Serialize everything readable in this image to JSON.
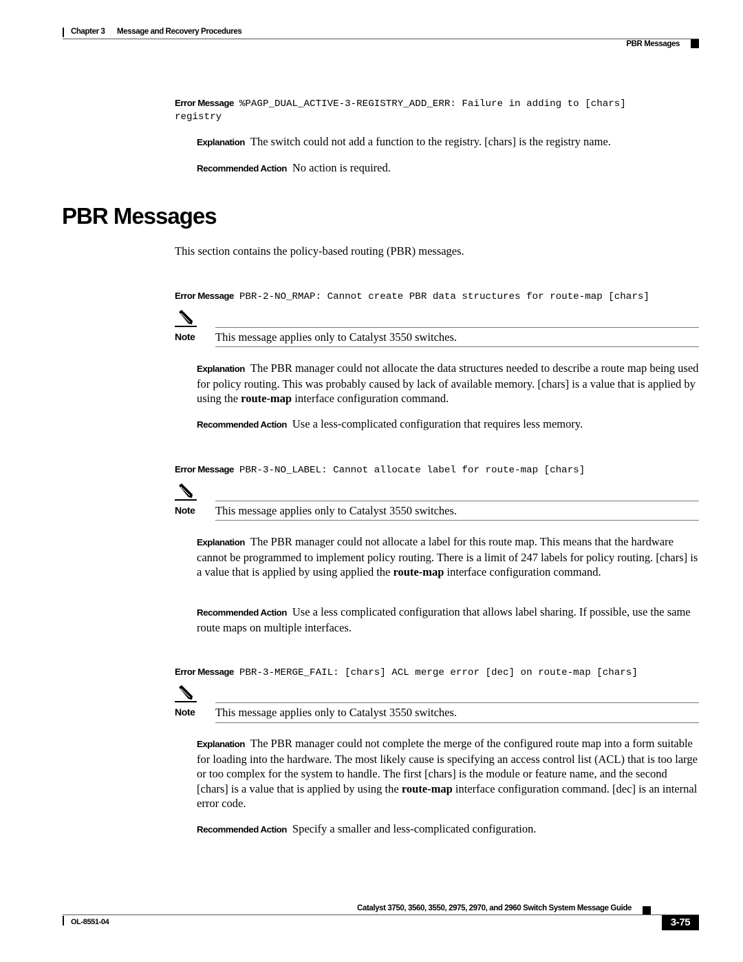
{
  "header": {
    "chapter": "Chapter 3",
    "chapter_title": "Message and Recovery Procedures",
    "section": "PBR Messages"
  },
  "entries_top": {
    "error_label": "Error Message",
    "error_code_line1": "%PAGP_DUAL_ACTIVE-3-REGISTRY_ADD_ERR: Failure in adding to [chars]",
    "error_code_line2": "registry",
    "explanation_label": "Explanation",
    "explanation": "The switch could not add a function to the registry. [chars] is the registry name.",
    "action_label": "Recommended Action",
    "action": "No action is required."
  },
  "section": {
    "title": "PBR Messages",
    "intro": "This section contains the policy-based routing (PBR) messages."
  },
  "messages": [
    {
      "error_label": "Error Message",
      "code": "PBR-2-NO_RMAP: Cannot create PBR data structures for route-map [chars]",
      "note_label": "Note",
      "note": "This message applies only to Catalyst 3550 switches.",
      "explanation_label": "Explanation",
      "explanation_pre": "The PBR manager could not allocate the data structures needed to describe a route map being used for policy routing. This was probably caused by lack of available memory. [chars] is a value that is applied by using the ",
      "explanation_kw": "route-map",
      "explanation_post": " interface configuration command.",
      "action_label": "Recommended Action",
      "action": "Use a less-complicated configuration that requires less memory."
    },
    {
      "error_label": "Error Message",
      "code": "PBR-3-NO_LABEL: Cannot allocate label for route-map [chars]",
      "note_label": "Note",
      "note": "This message applies only to Catalyst 3550 switches.",
      "explanation_label": "Explanation",
      "explanation_pre": "The PBR manager could not allocate a label for this route map. This means that the hardware cannot be programmed to implement policy routing. There is a limit of 247 labels for policy routing. [chars] is a value that is applied by using applied the ",
      "explanation_kw": "route-map",
      "explanation_post": " interface configuration command.",
      "action_label": "Recommended Action",
      "action": "Use a less complicated configuration that allows label sharing. If possible, use the same route maps on multiple interfaces."
    },
    {
      "error_label": "Error Message",
      "code": "PBR-3-MERGE_FAIL: [chars] ACL merge error [dec] on route-map [chars]",
      "note_label": "Note",
      "note": "This message applies only to Catalyst 3550 switches.",
      "explanation_label": "Explanation",
      "explanation_pre": "The PBR manager could not complete the merge of the configured route map into a form suitable for loading into the hardware. The most likely cause is specifying an access control list (ACL) that is too large or too complex for the system to handle. The first [chars] is the module or feature name, and the second [chars] is a value that is applied by using the ",
      "explanation_kw": "route-map",
      "explanation_post": " interface configuration command. [dec] is an internal error code.",
      "action_label": "Recommended Action",
      "action": "Specify a smaller and less-complicated configuration."
    }
  ],
  "footer": {
    "guide_title": "Catalyst 3750, 3560, 3550, 2975, 2970, and 2960 Switch System Message Guide",
    "doc_number": "OL-8551-04",
    "page_number": "3-75"
  },
  "icons": {
    "note": "pencil-icon"
  }
}
